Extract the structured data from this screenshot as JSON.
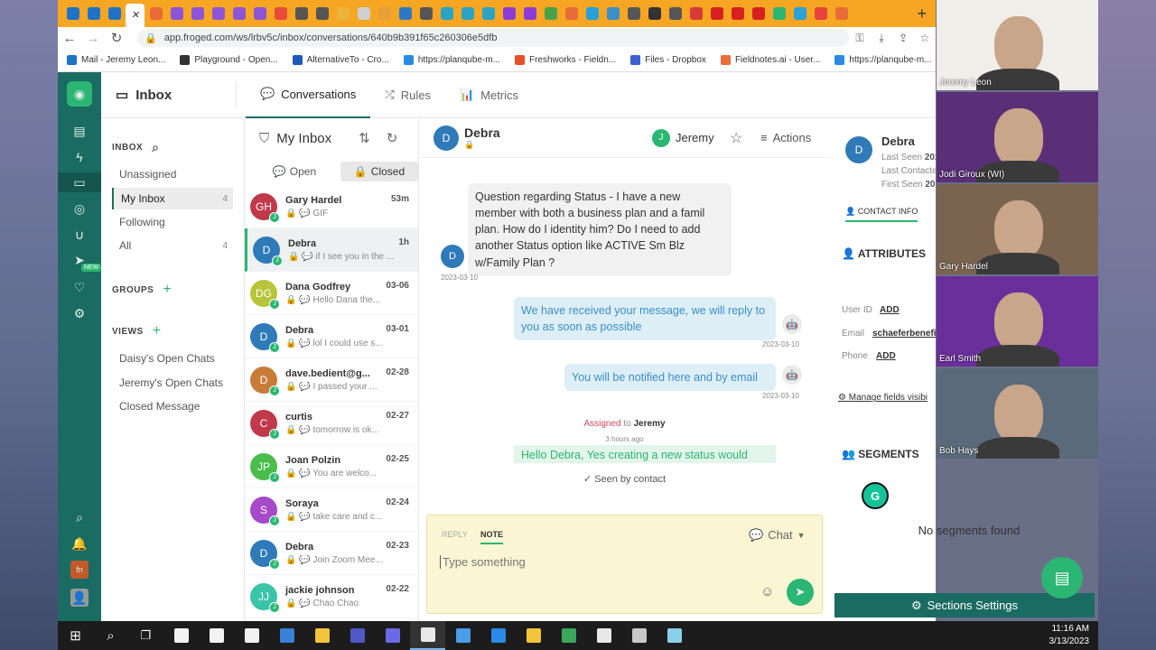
{
  "browser": {
    "url": "app.froged.com/ws/lrbv5c/inbox/conversations/640b9b391f65c260306e5dfb",
    "tab_colors": [
      "#1e73c9",
      "#1e73c9",
      "#1e73c9",
      "#ffffff",
      "#e86b3a",
      "#8c54d8",
      "#8c54d8",
      "#8c54d8",
      "#8c54d8",
      "#8c54d8",
      "#e84b3a",
      "#555555",
      "#555555",
      "#e8b43a",
      "#cfcfcf",
      "#e89f3a",
      "#2d78c4",
      "#555555",
      "#2ba3c4",
      "#2ba3c4",
      "#2ba3c4",
      "#8c3ad8",
      "#8c3ad8",
      "#4aa14b",
      "#e86b3a",
      "#26a0d8",
      "#3a8fc8",
      "#555555",
      "#333333",
      "#555555",
      "#d83a3a",
      "#d82020",
      "#d82020",
      "#d82020",
      "#2bb673",
      "#2aa3d8",
      "#e8423a",
      "#e86b3a"
    ],
    "bookmarks": [
      {
        "label": "Mail - Jeremy Leon...",
        "color": "#1e73c9"
      },
      {
        "label": "Playground - Open...",
        "color": "#333333"
      },
      {
        "label": "AlternativeTo - Cro...",
        "color": "#1e5bb8"
      },
      {
        "label": "https://planqube-m...",
        "color": "#2a8ae0"
      },
      {
        "label": "Freshworks - Fieldn...",
        "color": "#e8502a"
      },
      {
        "label": "Files - Dropbox",
        "color": "#3a5fcf"
      },
      {
        "label": "Fieldnotes.ai - User...",
        "color": "#e86b3a"
      },
      {
        "label": "https://planqube-m...",
        "color": "#2a8ae0"
      }
    ]
  },
  "app": {
    "rail_color": "#1a6b62",
    "accent": "#2bb673",
    "nav": {
      "inbox": "Inbox",
      "conversations": "Conversations",
      "rules": "Rules",
      "metrics": "Metrics",
      "new_badge": "NEW"
    },
    "sidebar": {
      "inbox_header": "INBOX",
      "items": [
        {
          "label": "Unassigned",
          "count": ""
        },
        {
          "label": "My Inbox",
          "count": "4"
        },
        {
          "label": "Following",
          "count": ""
        },
        {
          "label": "All",
          "count": "4"
        }
      ],
      "groups_header": "GROUPS",
      "views_header": "VIEWS",
      "views": [
        "Daisy's Open Chats",
        "Jeremy's Open Chats",
        "Closed Message"
      ]
    },
    "list": {
      "title": "My Inbox",
      "tab_open": "Open",
      "tab_closed": "Closed",
      "items": [
        {
          "initials": "GH",
          "name": "Gary Hardel",
          "time": "53m",
          "preview": "GIF",
          "color": "#c0394a"
        },
        {
          "initials": "D",
          "name": "Debra",
          "time": "1h",
          "preview": "if I see you in the ...",
          "color": "#2f7ab8"
        },
        {
          "initials": "DG",
          "name": "Dana Godfrey",
          "time": "03-06",
          "preview": "Hello Dana the...",
          "color": "#b8c43a"
        },
        {
          "initials": "D",
          "name": "Debra",
          "time": "03-01",
          "preview": "lol I could use s...",
          "color": "#2f7ab8"
        },
        {
          "initials": "D",
          "name": "dave.bedient@g...",
          "time": "02-28",
          "preview": "I passed your ...",
          "color": "#c97b3a"
        },
        {
          "initials": "C",
          "name": "curtis",
          "time": "02-27",
          "preview": "tomorrow is ok...",
          "color": "#c0394a"
        },
        {
          "initials": "JP",
          "name": "Joan Polzin",
          "time": "02-25",
          "preview": "You are welco...",
          "color": "#4bbd4b"
        },
        {
          "initials": "S",
          "name": "Soraya",
          "time": "02-24",
          "preview": "take care and c...",
          "color": "#a64ac9"
        },
        {
          "initials": "D",
          "name": "Debra",
          "time": "02-23",
          "preview": "Join Zoom Mee...",
          "color": "#2f7ab8"
        },
        {
          "initials": "JJ",
          "name": "jackie johnson",
          "time": "02-22",
          "preview": "Chao Chao",
          "color": "#3ac4a8"
        }
      ],
      "sub_badge": "J"
    },
    "chat": {
      "contact_initial": "D",
      "contact": "Debra",
      "agent_initial": "J",
      "agent": "Jeremy",
      "actions": "Actions",
      "msg1": "Question regarding Status - I have a new member with both a business plan and a famil plan.  How do I identity him?  Do I need to add another Status option like ACTIVE Sm Blz w/Family Plan ?",
      "msg1_date": "2023-03-10",
      "msg2": "We have received your message, we will reply to you as soon as possible",
      "msg2_date": "2023-03-10",
      "msg3": "You will be notified here and by email",
      "msg3_date": "2023-03-10",
      "assigned_label": "Assigned",
      "assigned_to": "to",
      "assigned_name": "Jeremy",
      "assigned_time": "3 hours ago",
      "msg4": "Hello Debra, Yes creating a new status would",
      "seen": "Seen by contact",
      "reply_tab": "REPLY",
      "note_tab": "NOTE",
      "channel": "Chat",
      "placeholder": "Type something"
    },
    "details": {
      "initial": "D",
      "name": "Debra",
      "last_seen": "Last Seen",
      "last_seen_val": "202",
      "last_contacted": "Last Contacte",
      "first_seen": "First Seen",
      "first_seen_val": "20",
      "contact_info_tab": "CONTACT INFO",
      "attributes": "ATTRIBUTES",
      "user_id": "User ID",
      "add": "ADD",
      "email": "Email",
      "email_val": "schaeferbenefit",
      "phone": "Phone",
      "manage": "Manage fields visibi",
      "segments": "SEGMENTS",
      "no_segments": "No segments found",
      "sections_btn": "Sections Settings"
    }
  },
  "video": [
    {
      "name": "Jeremy Leon",
      "bg": "#f0eee9"
    },
    {
      "name": "Jodi Giroux (WI)",
      "bg": "#5a2f78"
    },
    {
      "name": "Gary Hardel",
      "bg": "#7a6450"
    },
    {
      "name": "Earl Smith",
      "bg": "#6a2f9a"
    },
    {
      "name": "Bob Hays",
      "bg": "#5a6a7a"
    }
  ],
  "taskbar": {
    "time": "11:16 AM",
    "date": "3/13/2023",
    "icons": [
      "#f2f2f2",
      "#f2f2f2",
      "#f2f2f2",
      "#3a7fd8",
      "#f2c43a",
      "#5058c8",
      "#6a6ae8",
      "#e8e8e8",
      "#4a9de8",
      "#2a8ae8",
      "#f2c43a",
      "#3aa85a",
      "#e8e8e8",
      "#c8c8c8",
      "#8ad0e8"
    ]
  }
}
